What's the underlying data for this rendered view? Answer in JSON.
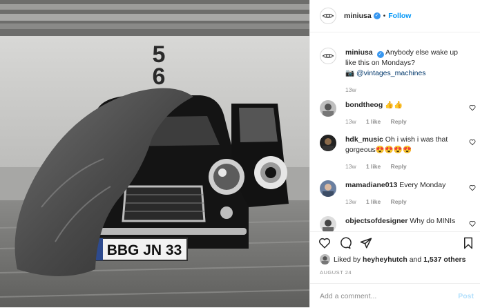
{
  "post": {
    "username": "miniusa",
    "verified_icon": "verified-badge-icon",
    "separator": "•",
    "follow_label": "Follow",
    "caption": {
      "username": "miniusa",
      "text": "Anybody else wake up like this on Mondays?",
      "camera_emoji": "📷",
      "mention": "@vintages_machines",
      "time": "13w"
    },
    "comments": [
      {
        "username": "bondtheog",
        "text": "👍👍",
        "time": "13w",
        "likes": "1 like",
        "reply": "Reply"
      },
      {
        "username": "hdk_music",
        "text": "Oh i wish i was that gorgeous😍😍😍😍",
        "time": "13w",
        "likes": "1 like",
        "reply": "Reply"
      },
      {
        "username": "mamadiane013",
        "text": "Every Monday",
        "time": "13w",
        "likes": "1 like",
        "reply": "Reply"
      },
      {
        "username": "objectsofdesigner",
        "text": "Why do MINIs"
      }
    ],
    "likes": {
      "prefix": "Liked by ",
      "user": "heyheyhutch",
      "and": " and ",
      "count": "1,537 others"
    },
    "date": "AUGUST 24",
    "add_comment_placeholder": "Add a comment...",
    "post_label": "Post",
    "photo": {
      "plate": "BBG JN 33",
      "stall_number": [
        "5",
        "6"
      ]
    }
  },
  "colors": {
    "accent": "#0095f6",
    "verified": "#3897f0",
    "post_disabled": "#b2dffc",
    "muted": "#8e8e8e"
  }
}
